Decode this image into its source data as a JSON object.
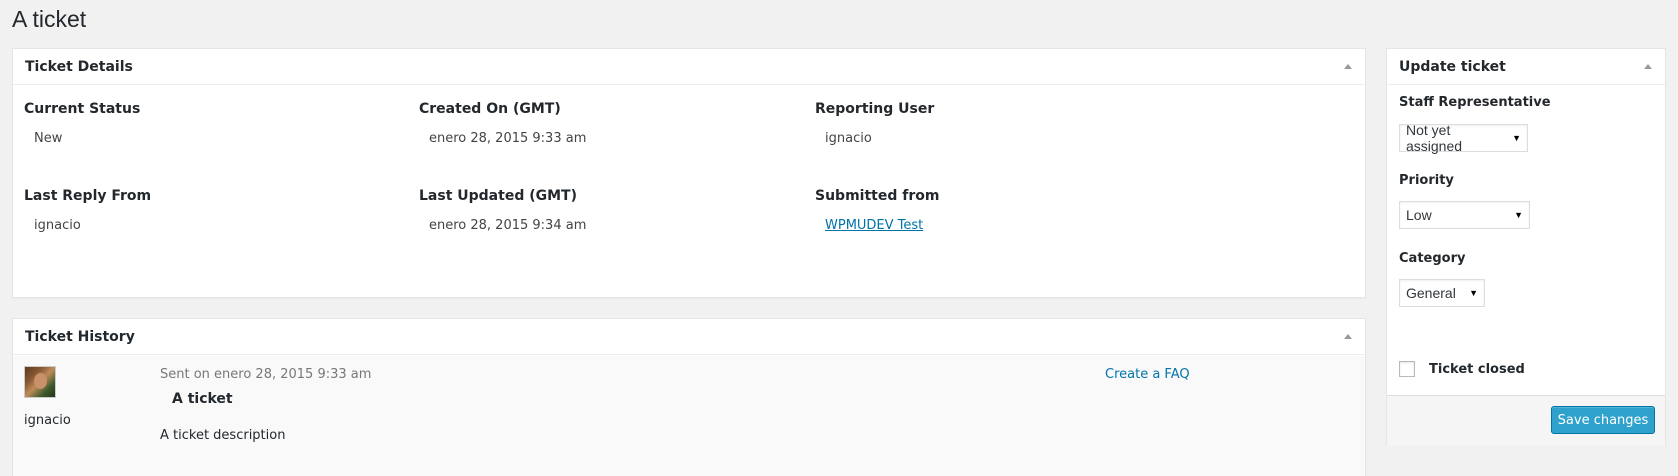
{
  "page": {
    "title": "A ticket"
  },
  "details": {
    "title": "Ticket Details",
    "current_status": {
      "label": "Current Status",
      "value": "New"
    },
    "created_on": {
      "label": "Created On (GMT)",
      "value": "enero 28, 2015 9:33 am"
    },
    "reporting_user": {
      "label": "Reporting User",
      "value": "ignacio"
    },
    "last_reply": {
      "label": "Last Reply From",
      "value": "ignacio"
    },
    "last_updated": {
      "label": "Last Updated (GMT)",
      "value": "enero 28, 2015 9:34 am"
    },
    "submitted_from": {
      "label": "Submitted from",
      "value": "WPMUDEV Test"
    }
  },
  "history": {
    "title": "Ticket History",
    "entries": [
      {
        "author": "ignacio",
        "sent": "Sent on enero 28, 2015 9:33 am",
        "subject": "A ticket",
        "message": "A ticket description",
        "action": "Create a FAQ"
      }
    ]
  },
  "update": {
    "title": "Update ticket",
    "staff": {
      "label": "Staff Representative",
      "value": "Not yet assigned"
    },
    "priority": {
      "label": "Priority",
      "value": "Low"
    },
    "category": {
      "label": "Category",
      "value": "General"
    },
    "closed": {
      "label": "Ticket closed",
      "checked": false
    },
    "save_label": "Save changes"
  },
  "colors": {
    "accent": "#2ea2cc",
    "link": "#0073aa",
    "background": "#f1f1f1"
  }
}
